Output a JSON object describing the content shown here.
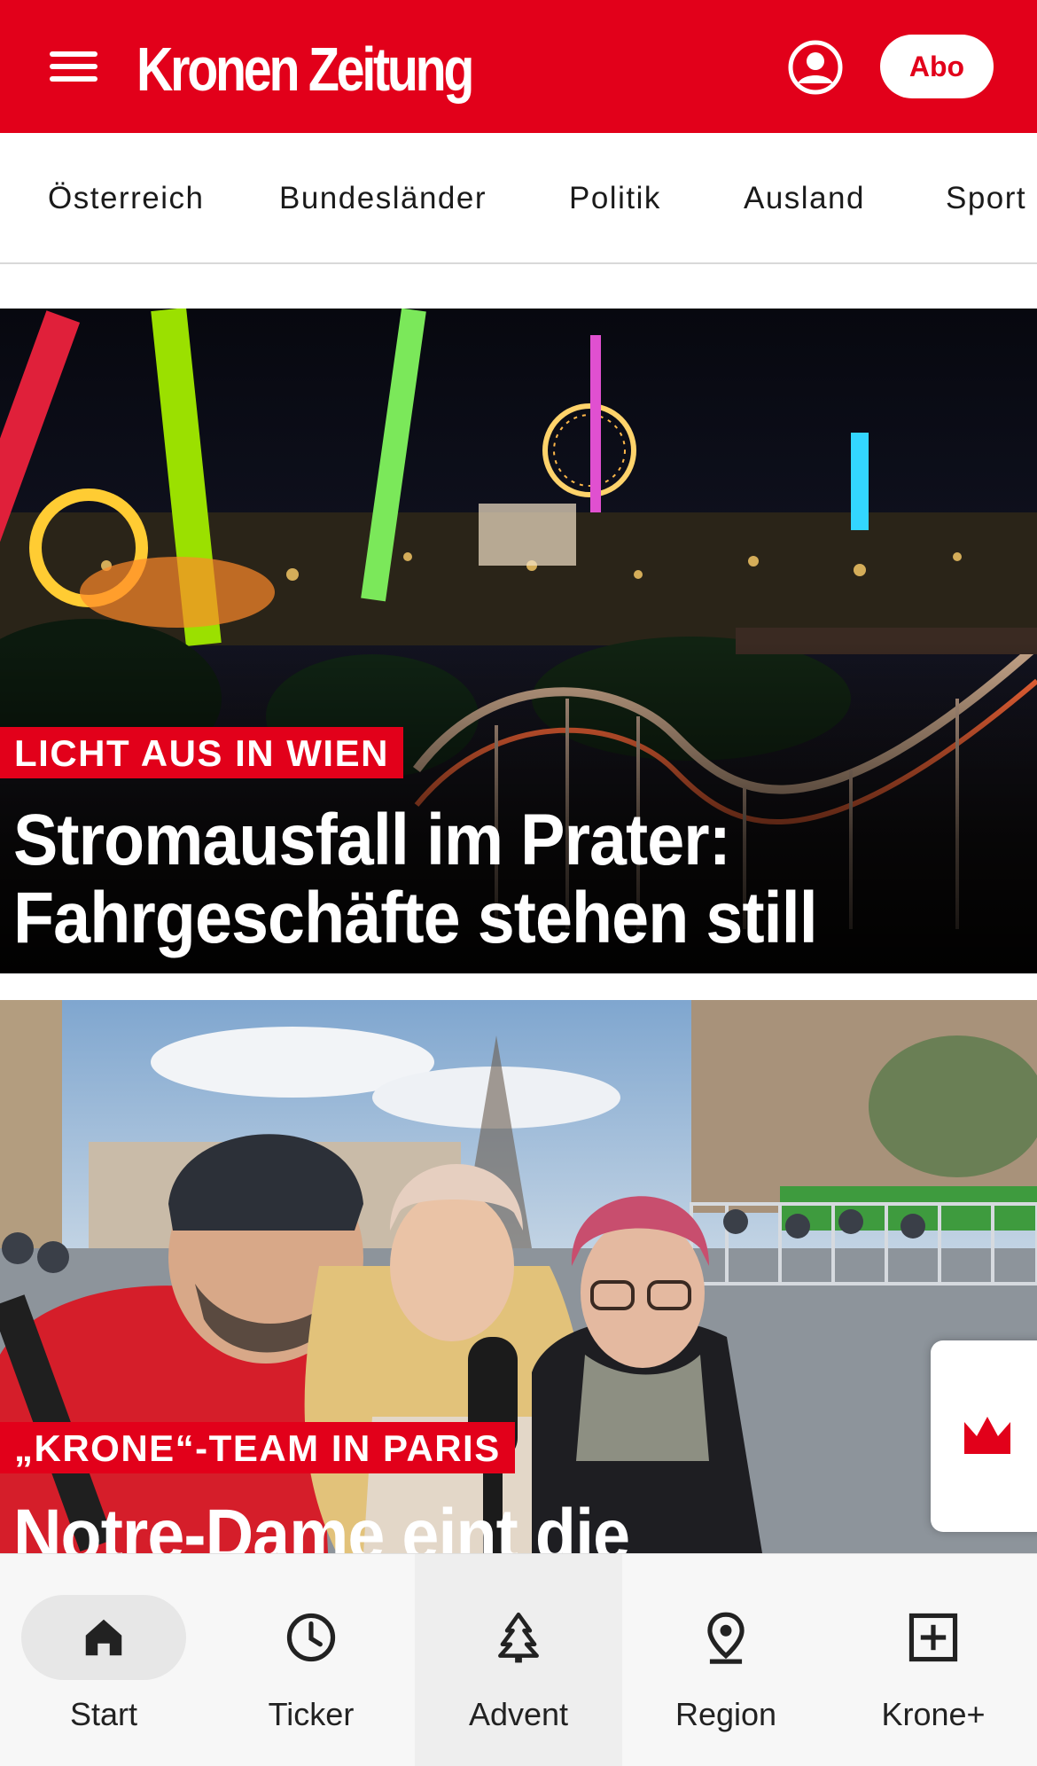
{
  "header": {
    "logo": "Kronen Zeitung",
    "abo_label": "Abo",
    "brand_color": "#e2001a"
  },
  "categories": [
    "Österreich",
    "Bundesländer",
    "Politik",
    "Ausland",
    "Sport"
  ],
  "articles": [
    {
      "kicker": "LICHT AUS IN WIEN",
      "headline_line1": "Stromausfall im Prater:",
      "headline_line2": "Fahrgeschäfte stehen still"
    },
    {
      "kicker": "„KRONE“-TEAM IN PARIS",
      "headline_line1": "Notre-Dame eint die"
    }
  ],
  "bottom_nav": {
    "items": [
      {
        "label": "Start",
        "icon": "home-icon"
      },
      {
        "label": "Ticker",
        "icon": "clock-icon"
      },
      {
        "label": "Advent",
        "icon": "tree-icon"
      },
      {
        "label": "Region",
        "icon": "location-pin-icon"
      },
      {
        "label": "Krone+",
        "icon": "plus-box-icon"
      }
    ]
  }
}
